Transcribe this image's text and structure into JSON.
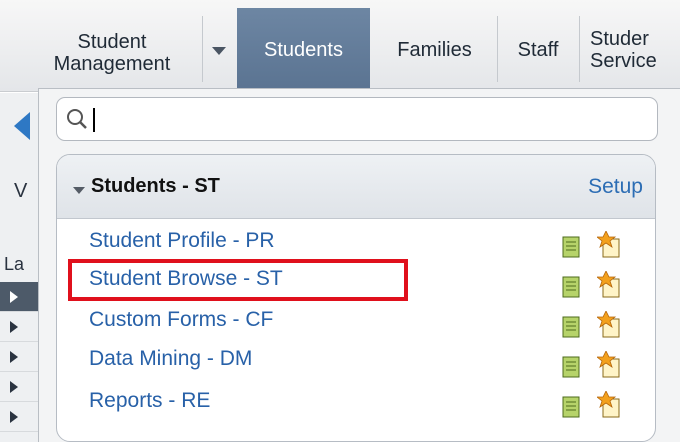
{
  "nav": {
    "module_line1": "Student",
    "module_line2": "Management",
    "tabs": [
      {
        "label": "Students",
        "active": true
      },
      {
        "label": "Families",
        "active": false
      },
      {
        "label": "Staff",
        "active": false
      },
      {
        "label_line1": "Studer",
        "label_line2": "Service",
        "active": false
      }
    ]
  },
  "left_panel": {
    "letter_top": "V",
    "letter_mid": "La"
  },
  "search": {
    "value": "",
    "placeholder": ""
  },
  "panel": {
    "title": "Students - ST",
    "setup_label": "Setup",
    "items": [
      {
        "label": "Student Profile - PR",
        "highlighted": false
      },
      {
        "label": "Student Browse - ST",
        "highlighted": true
      },
      {
        "label": "Custom Forms - CF",
        "highlighted": false
      },
      {
        "label": "Data Mining - DM",
        "highlighted": false
      },
      {
        "label": "Reports - RE",
        "highlighted": false
      }
    ]
  },
  "colors": {
    "active_tab": "#5f7896",
    "link": "#2861a8",
    "highlight": "#e0101c",
    "back_arrow": "#2e78c4"
  },
  "icons": [
    "search-icon",
    "dropdown-arrow-icon",
    "back-arrow-icon",
    "collapse-arrow-icon",
    "document-icon",
    "new-item-icon"
  ]
}
